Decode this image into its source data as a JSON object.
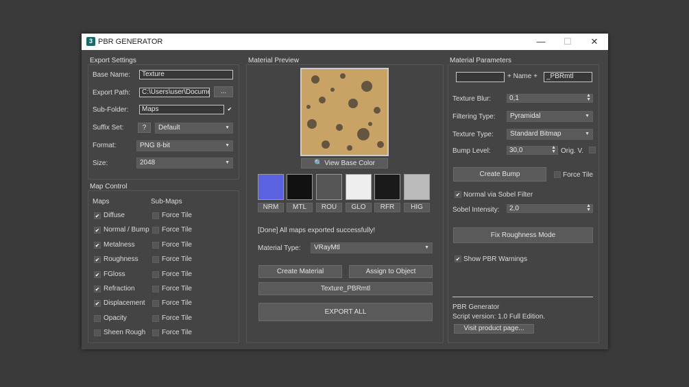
{
  "window": {
    "title": "PBR GENERATOR",
    "icon_text": "3",
    "minimize": "—",
    "maximize": "☐",
    "close": "✕"
  },
  "export": {
    "title": "Export Settings",
    "base_name_label": "Base Name:",
    "base_name_value": "Texture",
    "path_label": "Export Path:",
    "path_value": "C:\\Users\\user\\Docume",
    "browse": "...",
    "subfolder_label": "Sub-Folder:",
    "subfolder_value": "Maps",
    "suffix_label": "Suffix Set:",
    "suffix_help": "?",
    "suffix_value": "Default",
    "format_label": "Format:",
    "format_value": "PNG 8-bit",
    "size_label": "Size:",
    "size_value": "2048"
  },
  "mapcontrol": {
    "title": "Map Control",
    "maps_header": "Maps",
    "submaps_header": "Sub-Maps",
    "force_tile": "Force Tile",
    "maps": [
      {
        "label": "Diffuse",
        "checked": true
      },
      {
        "label": "Normal / Bump",
        "checked": true
      },
      {
        "label": "Metalness",
        "checked": true
      },
      {
        "label": "Roughness",
        "checked": true
      },
      {
        "label": "FGloss",
        "checked": true
      },
      {
        "label": "Refraction",
        "checked": true
      },
      {
        "label": "Displacement",
        "checked": true
      },
      {
        "label": "Opacity",
        "checked": false
      },
      {
        "label": "Sheen Rough",
        "checked": false
      }
    ]
  },
  "preview": {
    "title": "Material Preview",
    "view_base": "View Base Color",
    "thumbs": [
      "NRM",
      "MTL",
      "ROU",
      "GLO",
      "RFR",
      "HIG"
    ],
    "status": "[Done] All maps exported successfully!",
    "mat_type_label": "Material Type:",
    "mat_type_value": "VRayMtl",
    "create_material": "Create Material",
    "assign": "Assign to Object",
    "mat_name_btn": "Texture_PBRmtl",
    "export_all": "EXPORT ALL"
  },
  "params": {
    "title": "Material Parameters",
    "name_prefix": "",
    "name_mid": "+ Name +",
    "name_suffix": "_PBRmtl",
    "blur_label": "Texture Blur:",
    "blur_value": "0,1",
    "filter_label": "Filtering Type:",
    "filter_value": "Pyramidal",
    "ttype_label": "Texture Type:",
    "ttype_value": "Standard Bitmap",
    "bump_label": "Bump Level:",
    "bump_value": "30,0",
    "orig_label": "Orig. V.",
    "create_bump": "Create Bump",
    "force_tile": "Force Tile",
    "sobel_label": "Normal via Sobel Filter",
    "sobel_int_label": "Sobel Intensity:",
    "sobel_int_value": "2,0",
    "fix_rough": "Fix Roughness Mode",
    "warnings": "Show PBR Warnings",
    "about_title": "PBR Generator",
    "version": "Script version: 1.0 Full Edition.",
    "visit": "Visit product page..."
  }
}
